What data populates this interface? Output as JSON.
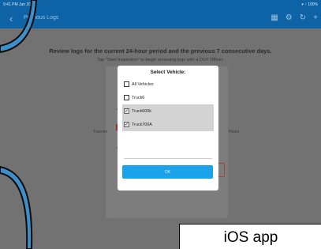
{
  "status_bar": {
    "left": "9:41 PM  Jan 20",
    "right": "▾ ↑ 100%"
  },
  "nav": {
    "back_icon": "chevron-left-icon",
    "title": "Previous Logs",
    "icons": [
      "export-icon",
      "settings-icon",
      "refresh-icon",
      "add-icon"
    ]
  },
  "content": {
    "headline": "Review logs for the current 24-hour period and the previous 7 consecutive days.",
    "subline": "Tap \"Start Inspection\" to begin reviewing logs with a DOT Officer.",
    "left_label": "Transfer",
    "right_label": "Hours"
  },
  "modal": {
    "title": "Select Vehicle:",
    "options": [
      {
        "label": "All Vehicles",
        "checked": false
      },
      {
        "label": "Truck6",
        "checked": false
      },
      {
        "label": "Truck600k",
        "checked": true
      },
      {
        "label": "Truck700A",
        "checked": true
      }
    ],
    "ok_label": "OK"
  },
  "caption": "iOS app",
  "colors": {
    "accent_blue": "#0d63a5",
    "ok_button": "#1aa2eb",
    "overlay_arc": "#3d8fc9",
    "selected_row": "#d3d3d3"
  }
}
